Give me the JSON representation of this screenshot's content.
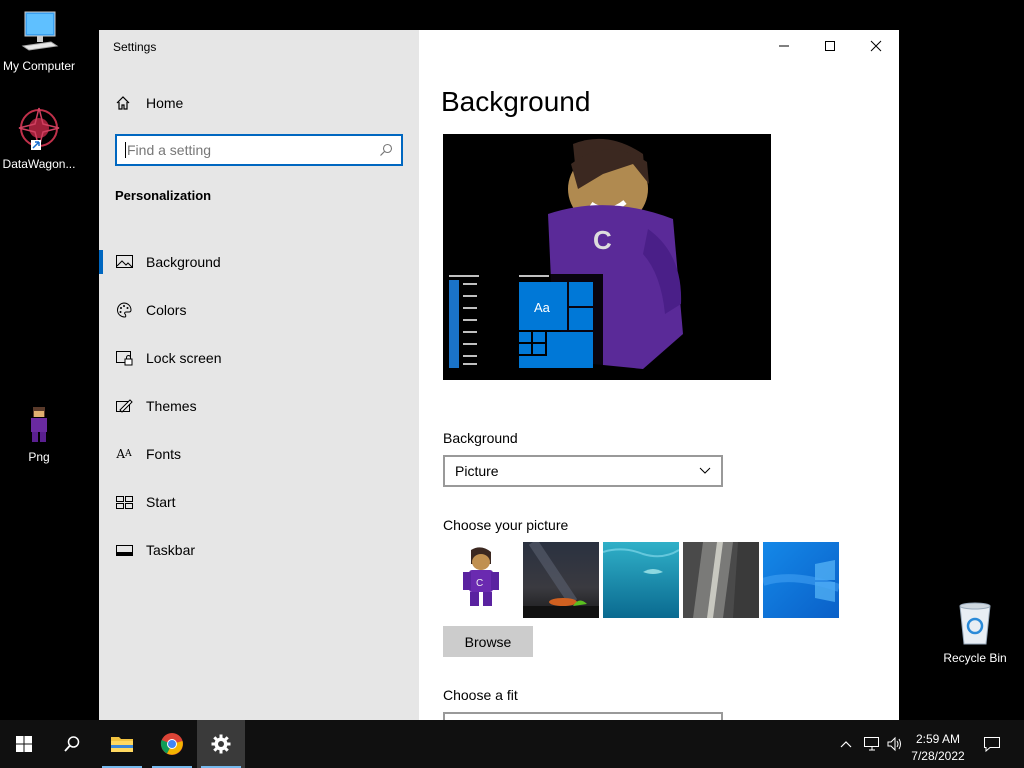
{
  "desktop": {
    "icons": [
      {
        "label": "My Computer"
      },
      {
        "label": "DataWagon..."
      },
      {
        "label": "Png"
      },
      {
        "label": "Recycle Bin"
      }
    ]
  },
  "window": {
    "title": "Settings",
    "controls": [
      "minimize",
      "maximize",
      "close"
    ]
  },
  "sidebar": {
    "home_label": "Home",
    "search_placeholder": "Find a setting",
    "section_title": "Personalization",
    "items": [
      {
        "label": "Background",
        "icon": "picture-icon",
        "active": true
      },
      {
        "label": "Colors",
        "icon": "palette-icon"
      },
      {
        "label": "Lock screen",
        "icon": "lock-screen-icon"
      },
      {
        "label": "Themes",
        "icon": "themes-icon"
      },
      {
        "label": "Fonts",
        "icon": "fonts-icon"
      },
      {
        "label": "Start",
        "icon": "start-icon"
      },
      {
        "label": "Taskbar",
        "icon": "taskbar-icon"
      }
    ]
  },
  "main": {
    "page_title": "Background",
    "preview_tile_text": "Aa",
    "background_label": "Background",
    "background_value": "Picture",
    "choose_picture_label": "Choose your picture",
    "browse_label": "Browse",
    "choose_fit_label": "Choose a fit"
  },
  "taskbar": {
    "time": "2:59 AM",
    "date": "7/28/2022"
  },
  "colors": {
    "accent": "#0067c0",
    "sidebar_bg": "#e6e6e6",
    "taskbar_bg": "#101010"
  }
}
